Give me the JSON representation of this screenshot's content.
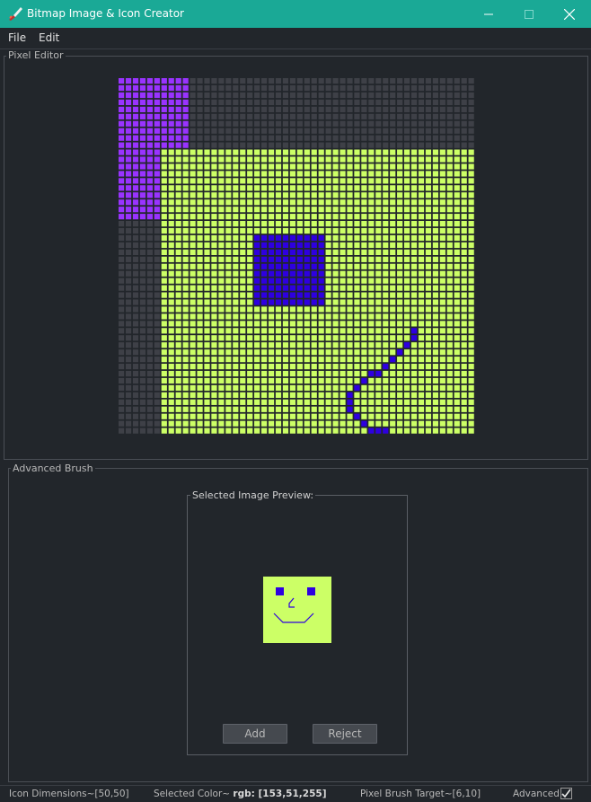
{
  "window": {
    "title": "Bitmap Image & Icon Creator"
  },
  "menu": {
    "items": [
      "File",
      "Edit"
    ]
  },
  "pixel_editor": {
    "group_title": "Pixel Editor",
    "grid_size": 50,
    "colors": {
      "empty": "#3e4047",
      "purple": "#9933ff",
      "yellow": "#ccff66",
      "blue": "#2e00e0"
    }
  },
  "advanced_brush": {
    "group_title": "Advanced Brush",
    "preview_title": "Selected Image Preview:",
    "add_label": "Add",
    "reject_label": "Reject",
    "preview_colors": {
      "background": "#ccff66",
      "features": "#2e00e0"
    }
  },
  "status": {
    "dimensions_label": "Icon Dimensions~",
    "dimensions_value": "[50,50]",
    "color_label": "Selected Color~ ",
    "color_value": "rgb: [153,51,255]",
    "target_label": "Pixel Brush Target~",
    "target_value": "[6,10]",
    "advanced_label": "Advanced:",
    "advanced_checked": true
  }
}
